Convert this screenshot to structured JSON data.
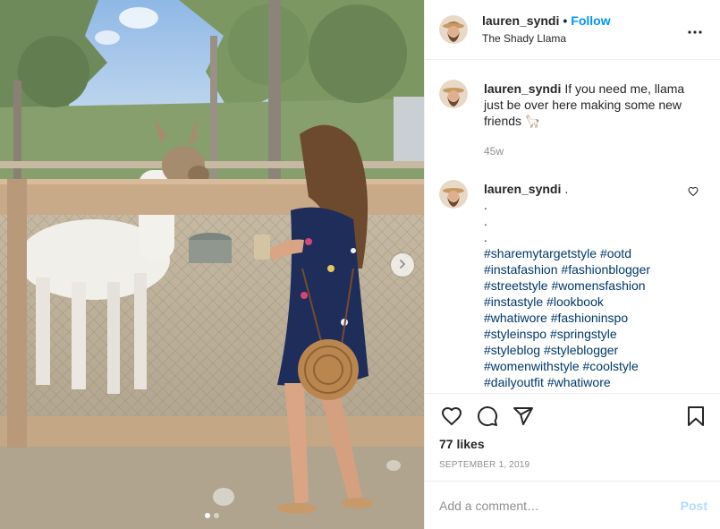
{
  "post": {
    "username": "lauren_syndi",
    "follow_label": "Follow",
    "separator": "•",
    "location": "The Shady Llama",
    "more_icon": "more-horizontal-icon"
  },
  "photo": {
    "next_icon": "chevron-right-icon",
    "carousel_total": 2,
    "carousel_active": 1
  },
  "caption": {
    "username": "lauren_syndi",
    "text": "If you need me, llama just be over here making some new friends 🦙",
    "time": "45w"
  },
  "comment": {
    "username": "lauren_syndi",
    "first": ".",
    "dots": [
      ".",
      ".",
      "."
    ],
    "hashtag_lines": [
      [
        "#sharemytargetstyle",
        "#ootd"
      ],
      [
        "#instafashion",
        "#fashionblogger"
      ],
      [
        "#streetstyle",
        "#womensfashion"
      ],
      [
        "#instastyle",
        "#lookbook"
      ],
      [
        "#whatiwore",
        "#fashioninspo"
      ],
      [
        "#styleinspo",
        "#springstyle"
      ],
      [
        "#styleblog",
        "#styleblogger"
      ],
      [
        "#womenwithstyle",
        "#coolstyle"
      ],
      [
        "#dailyoutfit",
        "#whatiwore"
      ]
    ],
    "like_icon": "heart-outline-icon"
  },
  "actions": {
    "like_icon": "heart-icon",
    "comment_icon": "comment-icon",
    "share_icon": "paper-plane-icon",
    "save_icon": "bookmark-icon"
  },
  "likes": "77 likes",
  "date": "SEPTEMBER 1, 2019",
  "add_comment": {
    "placeholder": "Add a comment…",
    "post_label": "Post"
  },
  "colors": {
    "accent": "#0095f6",
    "hashtag": "#00376b",
    "muted": "#8e8e8e",
    "post_disabled": "#b3dbff"
  }
}
